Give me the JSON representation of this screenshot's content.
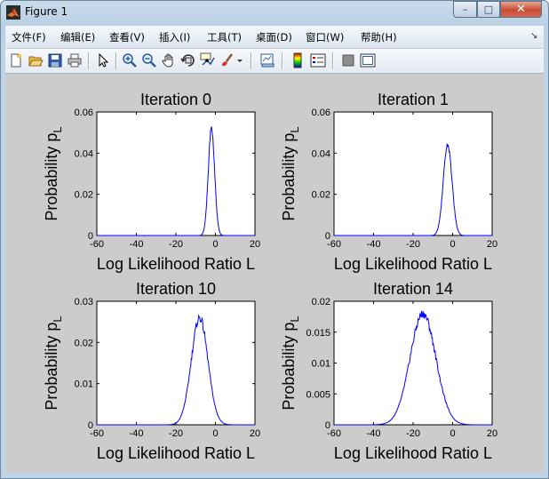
{
  "window": {
    "title": "Figure 1",
    "minimize_glyph": "–",
    "maximize_glyph": "□",
    "close_glyph": "✕"
  },
  "menubar": {
    "items": [
      "文件(F)",
      "编辑(E)",
      "查看(V)",
      "插入(I)",
      "工具(T)",
      "桌面(D)",
      "窗口(W)",
      "帮助(H)"
    ],
    "overflow_glyph": "↘"
  },
  "toolbar": {
    "icons": [
      "new-figure-icon",
      "open-file-icon",
      "save-icon",
      "print-icon",
      "edit-plot-arrow-icon",
      "zoom-in-icon",
      "zoom-out-icon",
      "pan-hand-icon",
      "rotate-3d-icon",
      "data-cursor-icon",
      "brush-icon",
      "brush-dropdown-icon",
      "link-plot-icon",
      "insert-colorbar-icon",
      "insert-legend-icon",
      "hide-plot-tools-icon",
      "show-plot-tools-icon"
    ]
  },
  "colors": {
    "figure_background": "#cccccc",
    "axes_background": "#ffffff",
    "line": "#0000ff"
  },
  "chart_data": [
    {
      "type": "line",
      "title": "Iteration 0",
      "xlabel": "Log Likelihood Ratio L",
      "ylabel": "Probability p",
      "ylabel_subscript": "L",
      "xlim": [
        -60,
        20
      ],
      "ylim": [
        0,
        0.06
      ],
      "xticks": [
        "-60",
        "-40",
        "-20",
        "0",
        "20"
      ],
      "yticks": [
        "0",
        "0.02",
        "0.04",
        "0.06"
      ],
      "series": [
        {
          "peak_x": -2,
          "peak_y": 0.052,
          "sigma": 1.6
        }
      ]
    },
    {
      "type": "line",
      "title": "Iteration 1",
      "xlabel": "Log Likelihood Ratio L",
      "ylabel": "Probability p",
      "ylabel_subscript": "L",
      "xlim": [
        -60,
        20
      ],
      "ylim": [
        0,
        0.06
      ],
      "xticks": [
        "-60",
        "-40",
        "-20",
        "0",
        "20"
      ],
      "yticks": [
        "0",
        "0.02",
        "0.04",
        "0.06"
      ],
      "series": [
        {
          "peak_x": -2.5,
          "peak_y": 0.044,
          "sigma": 2.2
        }
      ]
    },
    {
      "type": "line",
      "title": "Iteration 10",
      "xlabel": "Log Likelihood Ratio L",
      "ylabel": "Probability p",
      "ylabel_subscript": "L",
      "xlim": [
        -60,
        20
      ],
      "ylim": [
        0,
        0.03
      ],
      "xticks": [
        "-60",
        "-40",
        "-20",
        "0",
        "20"
      ],
      "yticks": [
        "0",
        "0.01",
        "0.02",
        "0.03"
      ],
      "series": [
        {
          "peak_x": -8,
          "peak_y": 0.026,
          "sigma": 4.2
        }
      ]
    },
    {
      "type": "line",
      "title": "Iteration 14",
      "xlabel": "Log Likelihood Ratio L",
      "ylabel": "Probability p",
      "ylabel_subscript": "L",
      "xlim": [
        -60,
        20
      ],
      "ylim": [
        0,
        0.02
      ],
      "xticks": [
        "-60",
        "-40",
        "-20",
        "0",
        "20"
      ],
      "yticks": [
        "0",
        "0.005",
        "0.01",
        "0.015",
        "0.02"
      ],
      "series": [
        {
          "peak_x": -15,
          "peak_y": 0.018,
          "sigma": 6.5
        }
      ]
    }
  ]
}
